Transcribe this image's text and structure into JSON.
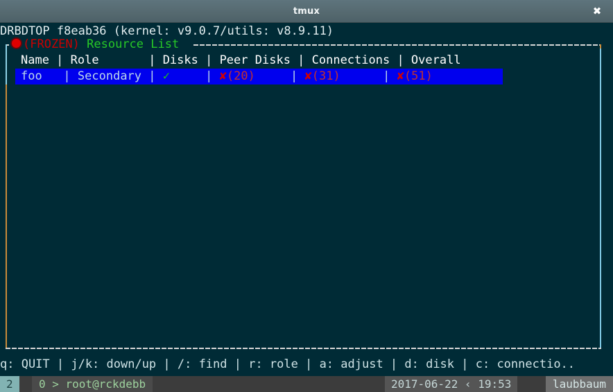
{
  "window": {
    "title": "tmux",
    "close_label": "✖"
  },
  "app": {
    "header": "DRBDTOP f8eab36 (kernel: v9.0.7/utils: v8.9.11)",
    "frozen_label": "(FROZEN)",
    "panel_title": "Resource List",
    "frozen_icon": "record-dot-icon"
  },
  "table": {
    "header_line": "Name | Role       | Disks | Peer Disks | Connections | Overall",
    "columns": [
      "Name",
      "Role",
      "Disks",
      "Peer Disks",
      "Connections",
      "Overall"
    ],
    "rows": [
      {
        "name": "foo",
        "role": "Secondary",
        "disks_icon": "✓",
        "disks_status": "ok",
        "peer_disks_icon": "✘",
        "peer_disks_count": "(20)",
        "connections_icon": "✘",
        "connections_count": "(31)",
        "overall_icon": "✘",
        "overall_count": "(51)",
        "selected": true
      }
    ]
  },
  "help": {
    "line": "q: QUIT | j/k: down/up | /: find | r: role | a: adjust | d: disk | c: connectio.."
  },
  "statusbar": {
    "session": "2",
    "window": "0 > root@rckdebb",
    "date": "2017-06-22 ‹ 19:53",
    "host": "laubbaum"
  },
  "colors": {
    "terminal_bg": "#002b36",
    "selection_bg": "#0000ee",
    "ok_green": "#1fbf1f",
    "bad_red": "#d40000",
    "frozen_red": "#cc0000",
    "panel_title_green": "#27c927",
    "border_orange": "#c98b3a",
    "border_blue": "#7ec8e3",
    "titlebar_bg": "#55696f"
  }
}
